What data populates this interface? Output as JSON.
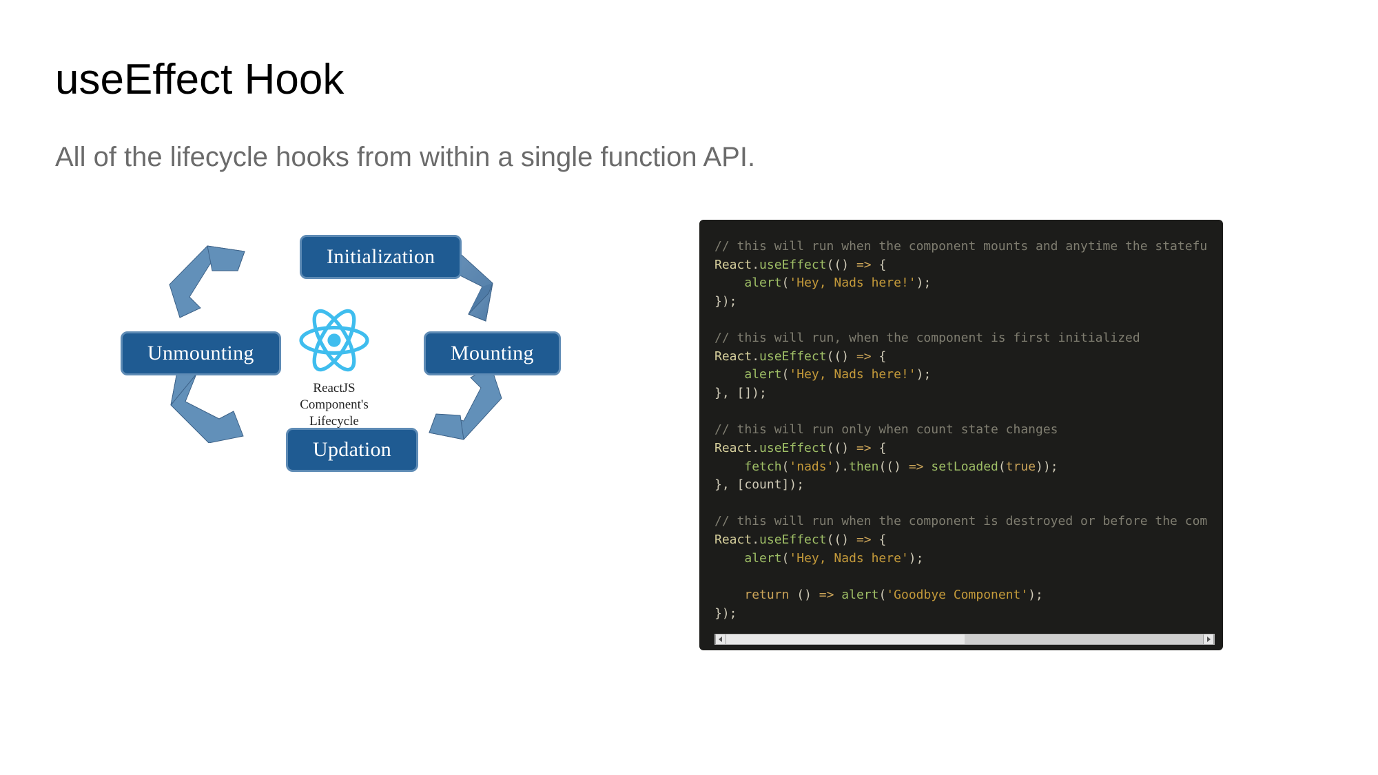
{
  "title": "useEffect Hook",
  "subtitle": "All of the lifecycle hooks from within a single function API.",
  "diagram": {
    "caption_line1": "ReactJS Component's",
    "caption_line2": "Lifecycle",
    "boxes": {
      "initialization": "Initialization",
      "mounting": "Mounting",
      "updation": "Updation",
      "unmounting": "Unmounting"
    }
  },
  "code": {
    "comment1": "// this will run when the component mounts and anytime the statefu",
    "line_open": "React.useEffect(() => {",
    "alert1": "alert('Hey, Nads here!');",
    "close1": "});",
    "comment2": "// this will run, when the component is first initialized",
    "close2": "}, []);",
    "comment3": "// this will run only when count state changes",
    "fetch": "fetch('nads').then(() => setLoaded(true));",
    "close3": "}, [count]);",
    "comment4": "// this will run when the component is destroyed or before the com",
    "alert2": "alert('Hey, Nads here');",
    "return": "return () => alert('Goodbye Component');",
    "tokens": {
      "React": "React",
      "useEffect": "useEffect",
      "alert": "alert",
      "fetch": "fetch",
      "then": "then",
      "setLoaded": "setLoaded",
      "return": "return",
      "count": "count",
      "true": "true",
      "str_hey_excl": "'Hey, Nads here!'",
      "str_hey": "'Hey, Nads here'",
      "str_nads": "'nads'",
      "str_goodbye": "'Goodbye Component'"
    }
  },
  "colors": {
    "box_fill": "#1f5b92",
    "box_border": "#5e8bb5",
    "arrow": "#5e8bb5",
    "react_logo": "#3fbdee",
    "code_bg": "#1c1c1a"
  }
}
